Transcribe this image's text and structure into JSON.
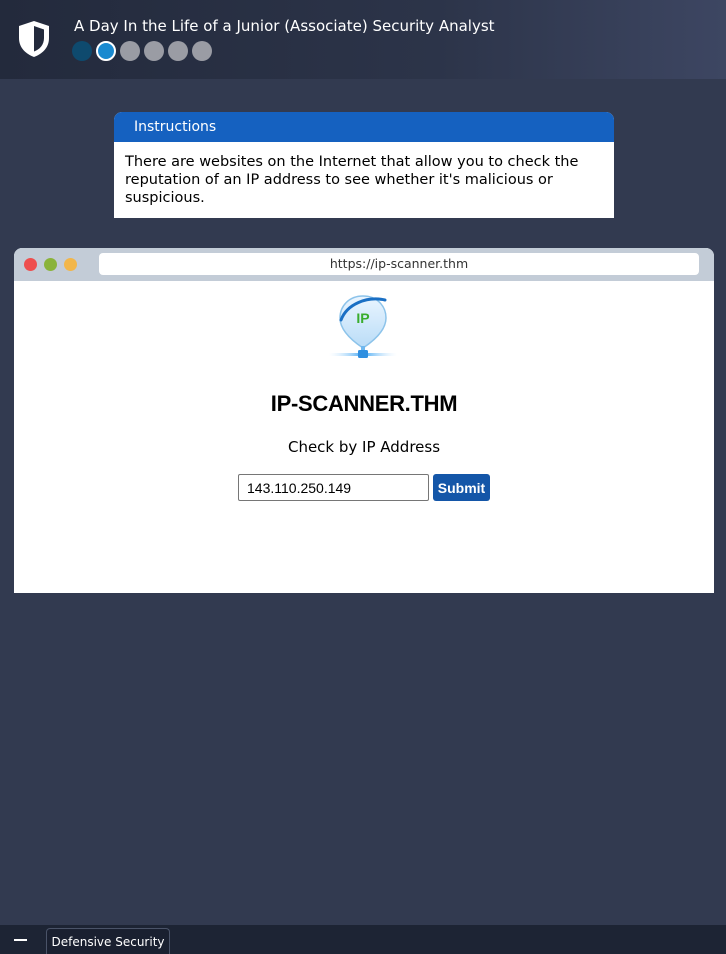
{
  "app": {
    "title": "A Day In the Life of a Junior (Associate) Security Analyst",
    "icon": "shield-icon",
    "progress": {
      "total_steps": 6,
      "completed_steps": 1,
      "current_step": 2
    }
  },
  "instructions": {
    "heading": "Instructions",
    "text": "There are websites on the Internet that allow you to check the reputation of an IP address to see whether it's malicious or suspicious."
  },
  "browser": {
    "url": "https://ip-scanner.thm",
    "site": {
      "logo_text": "IP",
      "title": "IP-SCANNER.THM",
      "subtitle": "Check by IP Address",
      "ip_value": "143.110.250.149",
      "submit_label": "Submit"
    }
  },
  "taskbar": {
    "tab_label": "Defensive Security"
  },
  "colors": {
    "accent": "#1561c0",
    "step_done": "#0e4a6e",
    "step_current": "#1a8ad0",
    "step_pending": "#9a9ca4",
    "background": "#323a50"
  }
}
